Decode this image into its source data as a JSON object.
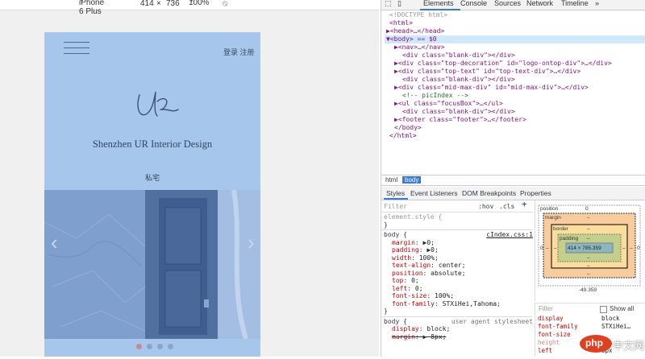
{
  "device_toolbar": {
    "device": "iPhone 6 Plus",
    "width": "414",
    "times": "×",
    "height": "736",
    "zoom": "100%"
  },
  "page": {
    "login": "登录",
    "register": "注册",
    "brand": "Shenzhen UR Interior Design",
    "subtitle": "私宅",
    "prev_arrow": "‹",
    "next_arrow": "›"
  },
  "devtools_tabs": {
    "elements": "Elements",
    "console": "Console",
    "sources": "Sources",
    "network": "Network",
    "timeline": "Timeline",
    "more": "»"
  },
  "dom_lines": [
    "<!DOCTYPE html>",
    "<html>",
    "▶<head>…</head>",
    "▼<body> == $0",
    "▶<nav>…</nav>",
    "<div class=\"blank-div\"></div>",
    "▶<div class=\"top-decoration\" id=\"logo-ontop-div\">…</div>",
    "▶<div class=\"top-text\" id=\"top-text-div\">…</div>",
    "<div class=\"blank-div\"></div>",
    "▶<div class=\"mid-max-div\" id=\"mid-max-div\">…</div>",
    "<!-- picIndex -->",
    "▶<ul class=\"focusBox\">…</ul>",
    "<div class=\"blank-div\"></div>",
    "▶<footer class=\"footer\">…</footer>",
    "</body>",
    "</html>"
  ],
  "crumbs": {
    "html": "html",
    "body": "body"
  },
  "subtabs": {
    "styles": "Styles",
    "event_listeners": "Event Listeners",
    "dom_breakpoints": "DOM Breakpoints",
    "properties": "Properties"
  },
  "styles_pane": {
    "filter_placeholder": "Filter",
    "hov": ":hov",
    "cls": ".cls",
    "plus": "+",
    "element_style": "element.style {",
    "close": "}",
    "body_selector": "body {",
    "body_source": "cIndex.css:1",
    "body_props": [
      {
        "k": "margin",
        "v": "▶0;"
      },
      {
        "k": "padding",
        "v": "▶0;"
      },
      {
        "k": "width",
        "v": "100%;"
      },
      {
        "k": "text-align",
        "v": "center;"
      },
      {
        "k": "position",
        "v": "absolute;"
      },
      {
        "k": "top",
        "v": "0;"
      },
      {
        "k": "left",
        "v": "0;"
      },
      {
        "k": "font-size",
        "v": "100%;"
      },
      {
        "k": "font-family",
        "v": "STXiHei,Tahoma;"
      }
    ],
    "ua_source": "user agent stylesheet",
    "ua_props": [
      {
        "k": "display",
        "v": "block;"
      },
      {
        "k": "margin",
        "v": "▶ 8px;"
      }
    ]
  },
  "box_model": {
    "position": "position",
    "position_val": "0",
    "margin": "margin",
    "border": "border",
    "padding": "padding",
    "dash": "–",
    "content": "414 × 785.359",
    "side_zero": "0",
    "bottom_val": "-49.359"
  },
  "computed": {
    "filter_placeholder": "Filter",
    "show_all": "Show all",
    "rows": [
      {
        "k": "display",
        "v": "block"
      },
      {
        "k": "font-family",
        "v": "STXiHei…"
      },
      {
        "k": "font-size",
        "v": ""
      },
      {
        "k": "height",
        "v": ""
      },
      {
        "k": "left",
        "v": "0px"
      }
    ]
  },
  "watermark": {
    "php": "php",
    "cn": "中文网"
  },
  "colors": {
    "page_bg": "#a7c6ec",
    "accent": "#3879d9",
    "tag": "#881280"
  }
}
